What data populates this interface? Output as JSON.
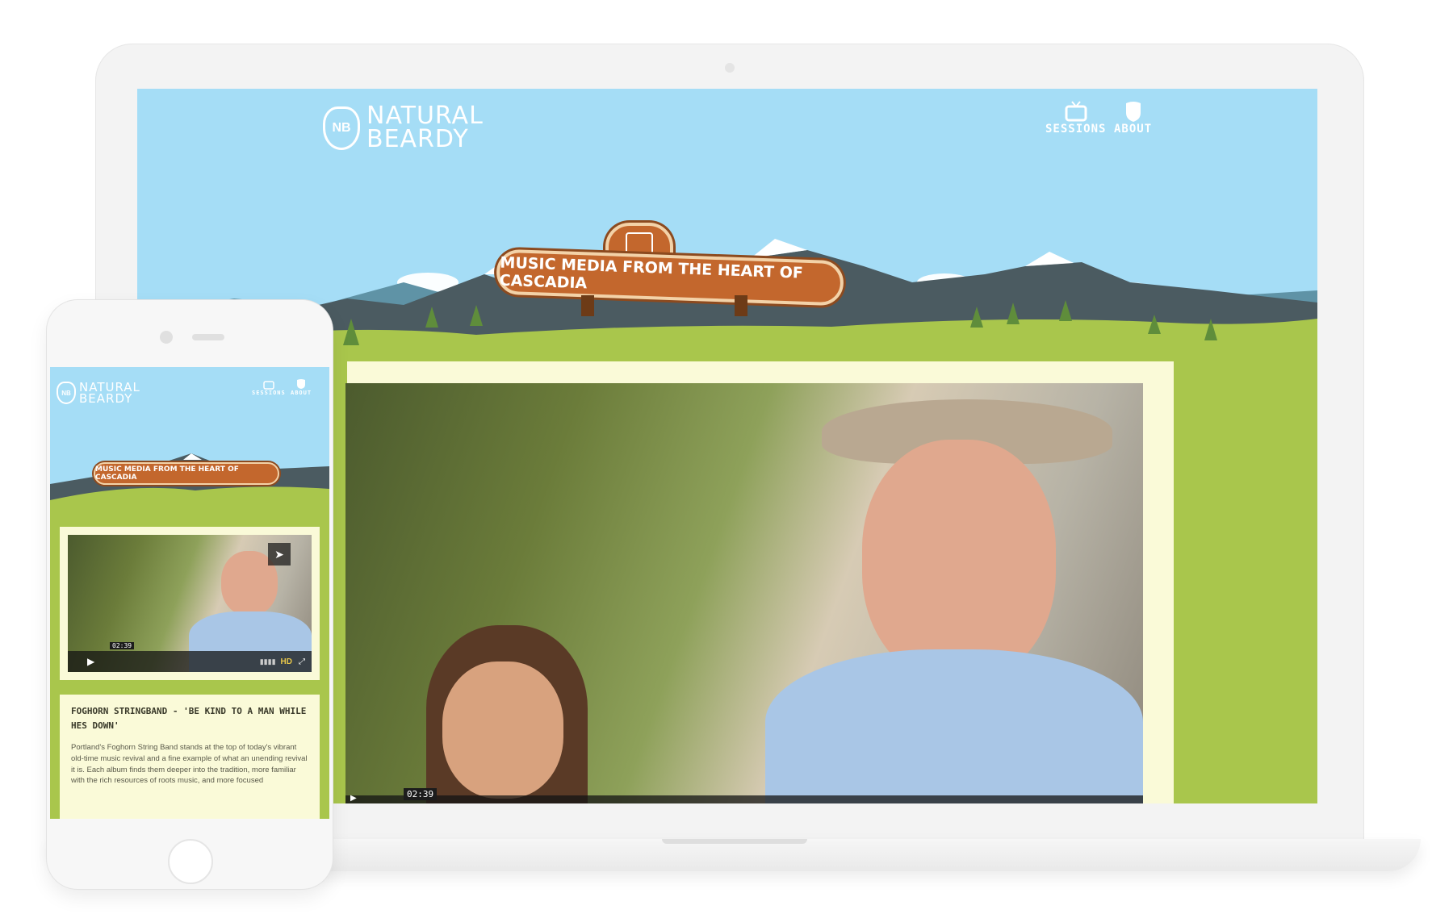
{
  "desktop": {
    "brand": {
      "badge": "NB",
      "line1": "NATURAL",
      "line2": "BEARDY"
    },
    "nav": [
      {
        "label": "SESSIONS",
        "icon": "tv-icon"
      },
      {
        "label": "ABOUT",
        "icon": "shield-logo-icon"
      }
    ],
    "sign_text": "Music media from the heart of Cascadia",
    "video": {
      "time": "02:39"
    }
  },
  "mobile": {
    "brand": {
      "badge": "NB",
      "line1": "NATURAL",
      "line2": "BEARDY"
    },
    "nav": [
      {
        "label": "SESSIONS",
        "icon": "tv-icon"
      },
      {
        "label": "ABOUT",
        "icon": "shield-logo-icon"
      }
    ],
    "sign_text": "Music media from the heart of Cascadia",
    "video": {
      "time": "02:39",
      "hd": "HD"
    },
    "post": {
      "title": "FOGHORN STRINGBAND - 'BE KIND TO A MAN WHILE HES DOWN'",
      "body": "Portland's Foghorn String Band stands at the top of today's vibrant old-time music revival and a fine example of what an unending revival it is. Each album finds them deeper into the tradition, more familiar with the rich resources of roots music, and more focused"
    }
  },
  "colors": {
    "sky": "#a5ddf6",
    "grass": "#a9c64c",
    "sign": "#c3672d",
    "card": "#fafad8"
  }
}
